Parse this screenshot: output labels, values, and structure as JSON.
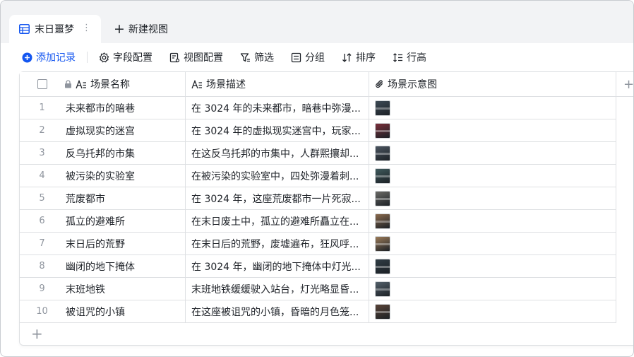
{
  "tabs": {
    "active_label": "末日噩梦",
    "more_icon": "more-vertical-icon",
    "new_view_label": "新建视图"
  },
  "toolbar": {
    "add_record": "添加记录",
    "field_config": "字段配置",
    "view_config": "视图配置",
    "filter": "筛选",
    "group": "分组",
    "sort": "排序",
    "row_height": "行高"
  },
  "columns": {
    "name": "场景名称",
    "desc": "场景描述",
    "image": "场景示意图"
  },
  "rows": [
    {
      "idx": "1",
      "name": "未来都市的暗巷",
      "desc": "在 3024 年的未来都市，暗巷中弥漫...",
      "thumb": "#3d4a55"
    },
    {
      "idx": "2",
      "name": "虚拟现实的迷宫",
      "desc": "在 3024 年的虚拟现实迷宫中，玩家...",
      "thumb": "#7a2f3a"
    },
    {
      "idx": "3",
      "name": "反乌托邦的市集",
      "desc": "在这反乌托邦的市集中，人群熙攘却...",
      "thumb": "#4b5560"
    },
    {
      "idx": "4",
      "name": "被污染的实验室",
      "desc": "在被污染的实验室中，四处弥漫着刺...",
      "thumb": "#3f5a5c"
    },
    {
      "idx": "5",
      "name": "荒废都市",
      "desc": "在 3024 年，这座荒废都市一片死寂...",
      "thumb": "#6b6a66"
    },
    {
      "idx": "6",
      "name": "孤立的避难所",
      "desc": "在末日废土中，孤立的避难所矗立在...",
      "thumb": "#8a6a4d"
    },
    {
      "idx": "7",
      "name": "末日后的荒野",
      "desc": "在末日后的荒野，废墟遍布，狂风呼...",
      "thumb": "#9b7b58"
    },
    {
      "idx": "8",
      "name": "幽闭的地下掩体",
      "desc": "在 3024 年，幽闭的地下掩体中灯光...",
      "thumb": "#2f3c44"
    },
    {
      "idx": "9",
      "name": "末班地铁",
      "desc": "末班地铁缓缓驶入站台，灯光略显昏...",
      "thumb": "#53606a"
    },
    {
      "idx": "10",
      "name": "被诅咒的小镇",
      "desc": "在这座被诅咒的小镇，昏暗的月色笼...",
      "thumb": "#5a4438"
    }
  ],
  "colors": {
    "accent": "#1456f0",
    "tab_strip_bg": "#f2f3f5",
    "border": "#dee0e3",
    "muted": "#8f959e"
  }
}
